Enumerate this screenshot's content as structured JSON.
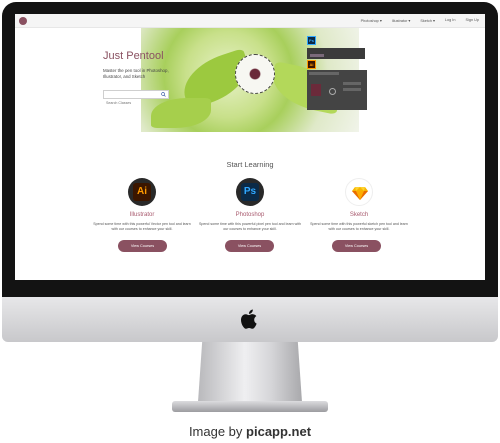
{
  "nav": {
    "items": [
      "Photoshop ▾",
      "Illustrator ▾",
      "Sketch ▾",
      "Log In",
      "Sign Up"
    ]
  },
  "hero": {
    "title": "Just Pentool",
    "subtitle": "Master the pen tool in Photoshop, Illustrator, and Sketch",
    "search_placeholder": "Search Classes",
    "ps_label": "Ps",
    "ai_label": "Ai"
  },
  "section": {
    "title": "Start Learning"
  },
  "courses": [
    {
      "badge": "Ai",
      "name": "Illustrator",
      "desc": "Spend some time with this powerful Vector pen tool and learn with our courses to enhance your skill.",
      "button": "View Courses"
    },
    {
      "badge": "Ps",
      "name": "Photoshop",
      "desc": "Spend some time with this powerful pixel pen tool and learn with our courses to enhance your skill.",
      "button": "View Courses"
    },
    {
      "badge": "",
      "name": "Sketch",
      "desc": "Spend some time with this powerful sketch pen tool and learn with our courses to enhance your skill.",
      "button": "View Courses"
    }
  ],
  "watermark": {
    "prefix": "Image by ",
    "brand": "picapp.net"
  },
  "colors": {
    "accent": "#8a5161",
    "ai": "#ff9a00",
    "ps": "#31a8ff",
    "sketch": "#f7b500"
  }
}
